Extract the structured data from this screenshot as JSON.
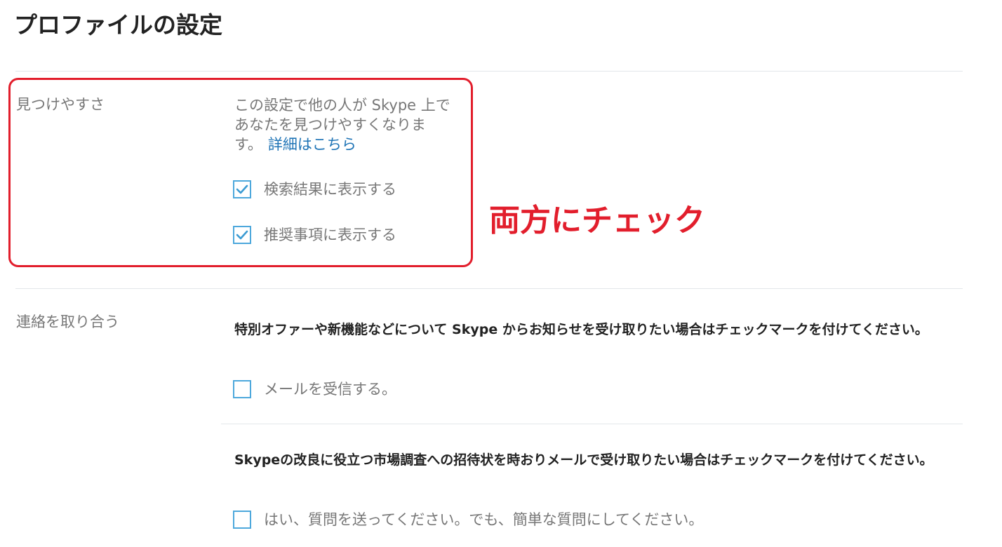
{
  "page": {
    "title": "プロファイルの設定"
  },
  "discoverability": {
    "label": "見つけやすさ",
    "description": "この設定で他の人が Skype 上であなたを見つけやすくなります。",
    "learn_more": "詳細はこちら",
    "options": [
      {
        "label": "検索結果に表示する",
        "checked": true
      },
      {
        "label": "推奨事項に表示する",
        "checked": true
      }
    ]
  },
  "annotation": {
    "text": "両方にチェック",
    "color": "#e21e2c"
  },
  "contact": {
    "label": "連絡を取り合う",
    "offers": {
      "text": "特別オファーや新機能などについて Skype からお知らせを受け取りたい場合はチェックマークを付けてください。",
      "option": {
        "label": "メールを受信する。",
        "checked": false
      }
    },
    "survey": {
      "text": "Skypeの改良に役立つ市場調査への招待状を時おりメールで受け取りたい場合はチェックマークを付けてください。",
      "option": {
        "label": "はい、質問を送ってください。でも、簡単な質問にしてください。",
        "checked": false
      }
    }
  },
  "colors": {
    "accent": "#4da8dc",
    "link": "#1f74b6",
    "divider": "#e3e7ea"
  }
}
